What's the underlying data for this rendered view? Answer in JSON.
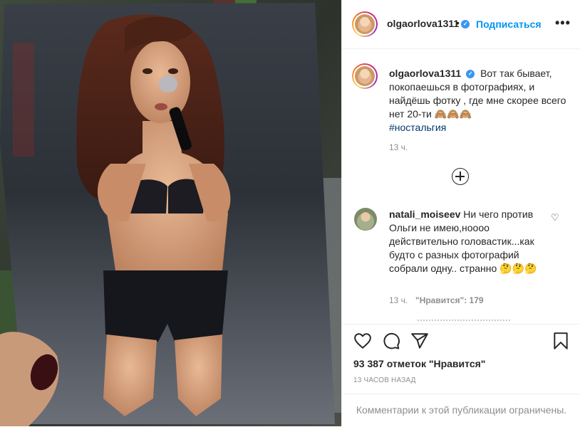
{
  "header": {
    "username": "olgaorlova1311",
    "verified_mark": "✓",
    "separator": "•",
    "follow_label": "Подписаться",
    "more_label": "•••"
  },
  "caption": {
    "username": "olgaorlova1311",
    "verified_mark": "✓",
    "text": "Вот так бывает, покопаешься в фотографиях, и найдёшь фотку , где мне скорее всего нет 20-ти 🙈🙈🙈",
    "hashtag": "#ностальгия",
    "time": "13 ч."
  },
  "comment": {
    "username": "natali_moiseev",
    "text": "Ни чего против Ольги не имею,ноооо действительно головастик...как будто с разных фотографий собрали одну.. странно 🤔🤔🤔",
    "time": "13 ч.",
    "likes": "\"Нравится\": 179"
  },
  "actions": {
    "icons": [
      "heart-icon",
      "comment-icon",
      "share-icon",
      "bookmark-icon"
    ],
    "likes_count": "93 387 отметок \"Нравится\"",
    "date": "13 ЧАСОВ НАЗАД",
    "comments_limited": "Комментарии к этой публикации ограничены."
  },
  "colors": {
    "accent": "#0095f6",
    "hashtag": "#00376b",
    "muted": "#8e8e8e",
    "text": "#262626"
  }
}
